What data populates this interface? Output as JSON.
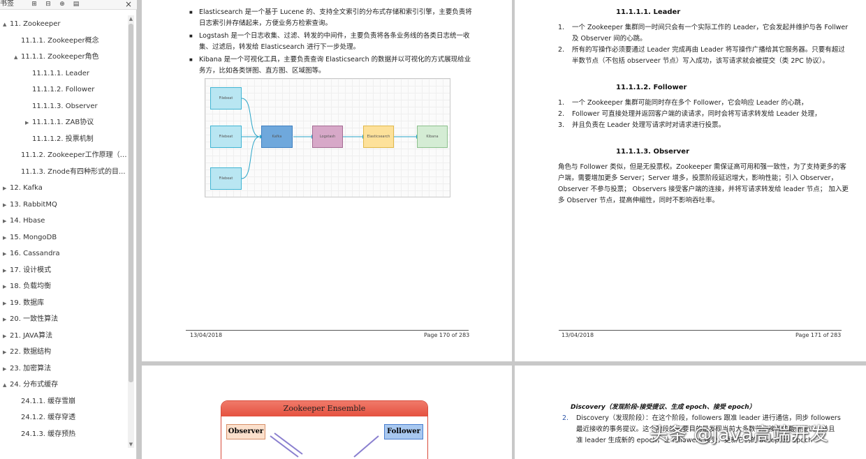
{
  "sidebar": {
    "toolbar_label": "书签",
    "toolbar_icons": [
      "expand-icon",
      "collapse-icon",
      "add-bookmark-icon",
      "bookmark-options-icon"
    ],
    "close": "×",
    "items": [
      {
        "label": "11. Zookeeper",
        "level": 0,
        "tw": "▲"
      },
      {
        "label": "11.1.1. Zookeeper概念",
        "level": 1,
        "tw": ""
      },
      {
        "label": "11.1.1. Zookeeper角色",
        "level": 1,
        "tw": "▲"
      },
      {
        "label": "11.1.1.1. Leader",
        "level": 2,
        "tw": ""
      },
      {
        "label": "11.1.1.2. Follower",
        "level": 2,
        "tw": ""
      },
      {
        "label": "11.1.1.3. Observer",
        "level": 2,
        "tw": ""
      },
      {
        "label": "11.1.1.1. ZAB协议",
        "level": 2,
        "tw": "▶"
      },
      {
        "label": "11.1.1.2. 投票机制",
        "level": 2,
        "tw": ""
      },
      {
        "label": "11.1.2. Zookeeper工作原理（原...",
        "level": 1,
        "tw": ""
      },
      {
        "label": "11.1.3.    Znode有四种形式的目...",
        "level": 1,
        "tw": ""
      },
      {
        "label": "12. Kafka",
        "level": 0,
        "tw": "▶"
      },
      {
        "label": "13. RabbitMQ",
        "level": 0,
        "tw": "▶"
      },
      {
        "label": "14. Hbase",
        "level": 0,
        "tw": "▶"
      },
      {
        "label": "15. MongoDB",
        "level": 0,
        "tw": "▶"
      },
      {
        "label": "16. Cassandra",
        "level": 0,
        "tw": "▶"
      },
      {
        "label": "17. 设计模式",
        "level": 0,
        "tw": "▶"
      },
      {
        "label": "18. 负载均衡",
        "level": 0,
        "tw": "▶"
      },
      {
        "label": "19. 数据库",
        "level": 0,
        "tw": "▶"
      },
      {
        "label": "20. 一致性算法",
        "level": 0,
        "tw": "▶"
      },
      {
        "label": "21. JAVA算法",
        "level": 0,
        "tw": "▶"
      },
      {
        "label": "22. 数据结构",
        "level": 0,
        "tw": "▶"
      },
      {
        "label": "23. 加密算法",
        "level": 0,
        "tw": "▶"
      },
      {
        "label": "24. 分布式缓存",
        "level": 0,
        "tw": "▲"
      },
      {
        "label": "24.1.1. 缓存雪崩",
        "level": 1,
        "tw": ""
      },
      {
        "label": "24.1.2. 缓存穿透",
        "level": 1,
        "tw": ""
      },
      {
        "label": "24.1.3. 缓存预热",
        "level": 1,
        "tw": ""
      }
    ]
  },
  "page170": {
    "bullets": [
      {
        "lines": [
          "Elasticsearch 是一个基于 Lucene 的、支持全文索引的分布式存储和索引引擎，主要负责将",
          "日志索引并存储起来，方便业务方检索查询。"
        ]
      },
      {
        "lines": [
          "Logstash 是一个日志收集、过滤、转发的中间件，主要负责将各条业务线的各类日志统一收",
          "集、过滤后，转发给 Elasticsearch 进行下一步处理。"
        ]
      },
      {
        "lines": [
          "Kibana 是一个可视化工具，主要负责查询 Elasticsearch 的数据并以可视化的方式展现给业",
          "务方，比如各类饼图、直方图、区域图等。"
        ]
      }
    ],
    "diagram": {
      "nodes": [
        "Filebeat",
        "Filebeat",
        "Filebeat",
        "Kafka",
        "Logstash",
        "Elasticsearch",
        "Kibana"
      ]
    },
    "footer_date": "13/04/2018",
    "footer_page": "Page 170 of 283"
  },
  "page171": {
    "h_leader": "11.1.1.1.  Leader",
    "leader_items": [
      {
        "num": "1.",
        "lines": [
          "一个 Zookeeper 集群同一时间只会有一个实际工作的 Leader，它会发起并维护与各 Follwer",
          "及 Observer 间的心跳。"
        ],
        "blue": false
      },
      {
        "num": "2.",
        "lines": [
          "所有的写操作必须要通过 Leader 完成再由 Leader 将写操作广播给其它服务器。只要有超过",
          "半数节点（不包括 observeer 节点）写入成功，该写请求就会被提交（类 2PC 协议）。"
        ],
        "blue": true
      }
    ],
    "h_follower": "11.1.1.2.  Follower",
    "follower_items": [
      {
        "num": "1.",
        "text": "一个 Zookeeper 集群可能同时存在多个 Follower，它会响应 Leader 的心跳，",
        "blue": false
      },
      {
        "num": "2.",
        "text": "Follower 可直接处理并返回客户端的读请求，同时会将写请求转发给 Leader 处理，",
        "blue": true
      },
      {
        "num": "3.",
        "text": "并且负责在 Leader 处理写请求时对请求进行投票。",
        "blue": false
      }
    ],
    "h_observer": "11.1.1.3.  Observer",
    "observer_lines": [
      "角色与 Follower 类似，但是无投票权。Zookeeper 需保证高可用和强一致性，为了支持更多的客",
      "户端，需要增加更多 Server；Server 增多，投票阶段延迟增大，影响性能；引入 Observer，",
      "Observer 不参与投票； Observers 接受客户端的连接，并将写请求转发给 leader 节点； 加入更",
      "多 Observer 节点，提高伸缩性，同时不影响吞吐率。"
    ],
    "footer_date": "13/04/2018",
    "footer_page": "Page 171 of 283"
  },
  "page172": {
    "ensemble_title": "Zookeeper Ensemble",
    "observer_label": "Observer",
    "follower_label": "Follower"
  },
  "page173": {
    "heading": "Discovery（发现阶段-接受提议、生成 epoch、接受 epoch）",
    "num": "2.",
    "lines": [
      "Discovery（发现阶段）：在这个阶段，followers 跟准 leader 进行通信，同步 followers",
      "最近接收的事务提议。这个阶段的主要目的是发现当前大多数节点接收的最新提议，并且",
      "准 leader 生成新的 epoch，让 followers 接受，更新它们的 accepted Epoch"
    ]
  },
  "watermark": "头条 @java高端开发",
  "colors": {
    "link_blue": "#2c54a8",
    "ensemble_red": "#e5513f"
  }
}
